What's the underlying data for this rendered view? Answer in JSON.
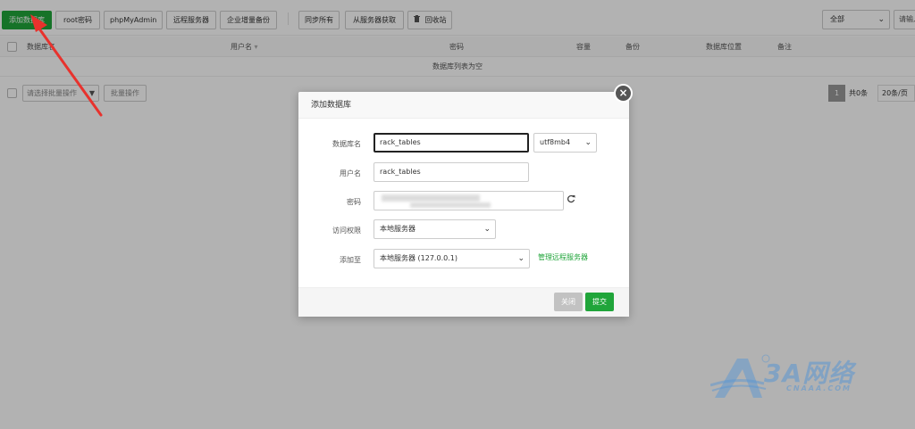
{
  "toolbar": {
    "add_db": "添加数据库",
    "root_pwd": "root密码",
    "phpmyadmin": "phpMyAdmin",
    "remote_server": "远程服务器",
    "enterprise_backup": "企业增量备份",
    "sync_all": "同步所有",
    "fetch_from_server": "从服务器获取",
    "recycle_bin": "回收站",
    "filter_value": "全部",
    "search_placeholder": "请输入数据库名称"
  },
  "table": {
    "columns": [
      "数据库名",
      "用户名",
      "密码",
      "容量",
      "备份",
      "数据库位置",
      "备注"
    ],
    "empty_text": "数据库列表为空"
  },
  "bottom": {
    "batch_placeholder": "请选择批量操作",
    "batch_button": "批量操作",
    "page_current": "1",
    "page_total": "共0条",
    "page_size": "20条/页"
  },
  "modal": {
    "title": "添加数据库",
    "close_glyph": "×",
    "db_name_label": "数据库名",
    "db_name_value": "rack_tables",
    "charset_value": "utf8mb4",
    "username_label": "用户名",
    "username_value": "rack_tables",
    "password_label": "密码",
    "access_label": "访问权限",
    "access_value": "本地服务器",
    "add_to_label": "添加至",
    "add_to_value": "本地服务器 (127.0.0.1)",
    "manage_remote_link": "管理远程服务器",
    "close_button": "关闭",
    "submit_button": "提交"
  },
  "watermark": {
    "brand": "3A网络",
    "domain": "CNAAA.COM"
  },
  "colors": {
    "primary_green": "#20a53a",
    "annotation_red": "#e8322d"
  },
  "icons": {
    "trash": "trash-icon",
    "refresh": "refresh-icon",
    "close": "close-icon",
    "chevron": "chevron-down-icon",
    "sort": "sort-icon"
  }
}
